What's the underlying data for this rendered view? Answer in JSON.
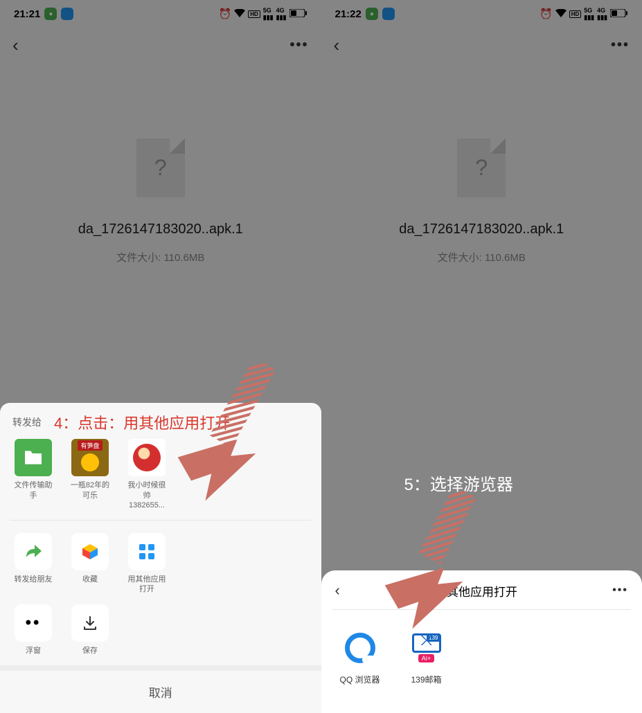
{
  "statusbar": {
    "left": {
      "time": "21:21",
      "time2": "21:22"
    },
    "right": {
      "alarm": "⏰",
      "wifi": "📶",
      "hd": "HD",
      "sig1": "5G",
      "sig2": "4G"
    }
  },
  "file": {
    "name": "da_1726147183020..apk.1",
    "size_label": "文件大小:",
    "size_value": "110.6MB",
    "unknown_mark": "?"
  },
  "share": {
    "forward_to": "转发给",
    "contacts": [
      {
        "name": "文件传输助手"
      },
      {
        "name": "一瓶82年的可乐",
        "banner": "有笋盘"
      },
      {
        "name": "我小时候很帅1382655..."
      }
    ],
    "actions": [
      {
        "label": "转发给朋友",
        "icon": "share-arrow"
      },
      {
        "label": "收藏",
        "icon": "cube"
      },
      {
        "label": "用其他应用打开",
        "icon": "grid"
      },
      {
        "label": "浮窗",
        "icon": "dots"
      },
      {
        "label": "保存",
        "icon": "download"
      }
    ],
    "cancel": "取消"
  },
  "open_with": {
    "title": "用其他应用打开",
    "apps": [
      {
        "label": "QQ 浏览器"
      },
      {
        "label": "139邮箱",
        "badge": "139",
        "ai": "AI+"
      }
    ]
  },
  "annotations": {
    "step4": "4：点击：用其他应用打开",
    "step5": "5：选择游览器"
  }
}
